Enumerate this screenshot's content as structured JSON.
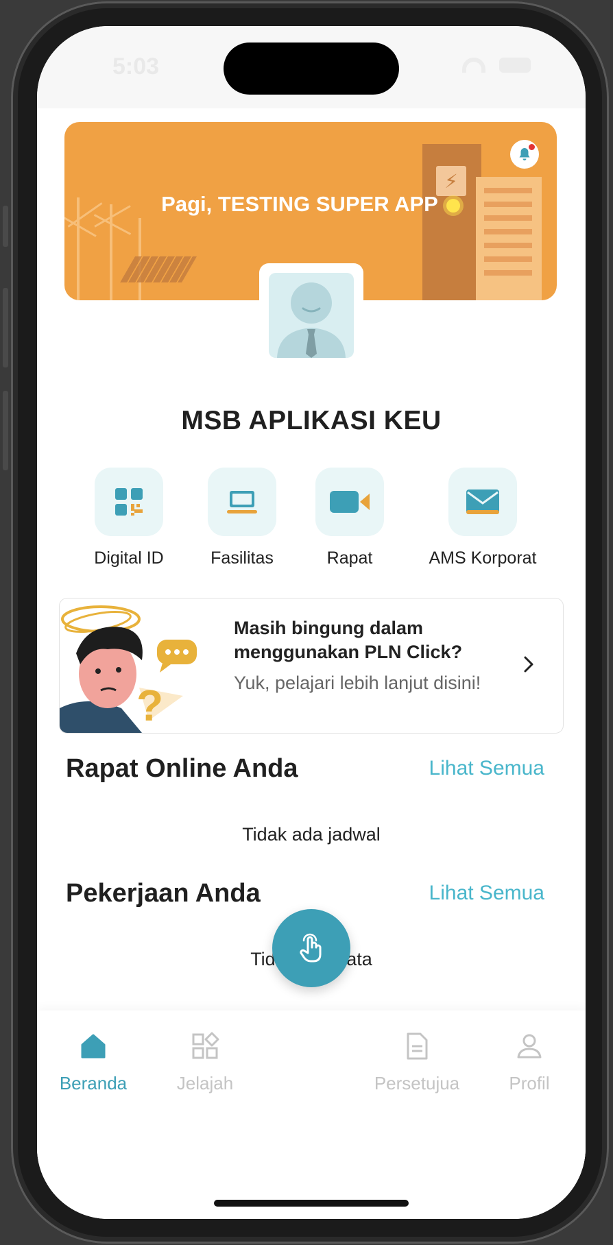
{
  "status_bar": {
    "time": "5:03"
  },
  "banner": {
    "greeting": "Pagi, TESTING SUPER APP",
    "bg_color": "#f0a144"
  },
  "app_title": "MSB APLIKASI KEU",
  "menu": [
    {
      "label": "Digital ID",
      "icon": "qr-code-icon"
    },
    {
      "label": "Fasilitas",
      "icon": "laptop-icon"
    },
    {
      "label": "Rapat",
      "icon": "video-camera-icon"
    },
    {
      "label": "AMS Korporat",
      "icon": "mail-icon"
    }
  ],
  "help_card": {
    "title": "Masih bingung dalam menggunakan PLN Click?",
    "subtitle": "Yuk, pelajari lebih lanjut disini!"
  },
  "sections": {
    "meetings": {
      "title": "Rapat Online Anda",
      "link": "Lihat Semua",
      "empty": "Tidak ada jadwal"
    },
    "tasks": {
      "title": "Pekerjaan Anda",
      "link": "Lihat Semua",
      "empty": "Tidak ada data"
    }
  },
  "nav": [
    {
      "label": "Beranda",
      "icon": "home-icon",
      "active": true
    },
    {
      "label": "Jelajah",
      "icon": "grid-explore-icon",
      "active": false
    },
    {
      "label": "Persetujua",
      "icon": "document-icon",
      "active": false
    },
    {
      "label": "Profil",
      "icon": "user-icon",
      "active": false
    }
  ],
  "colors": {
    "accent": "#3d9fb6",
    "link": "#49b6cb",
    "icon_bg": "#e9f6f7"
  }
}
